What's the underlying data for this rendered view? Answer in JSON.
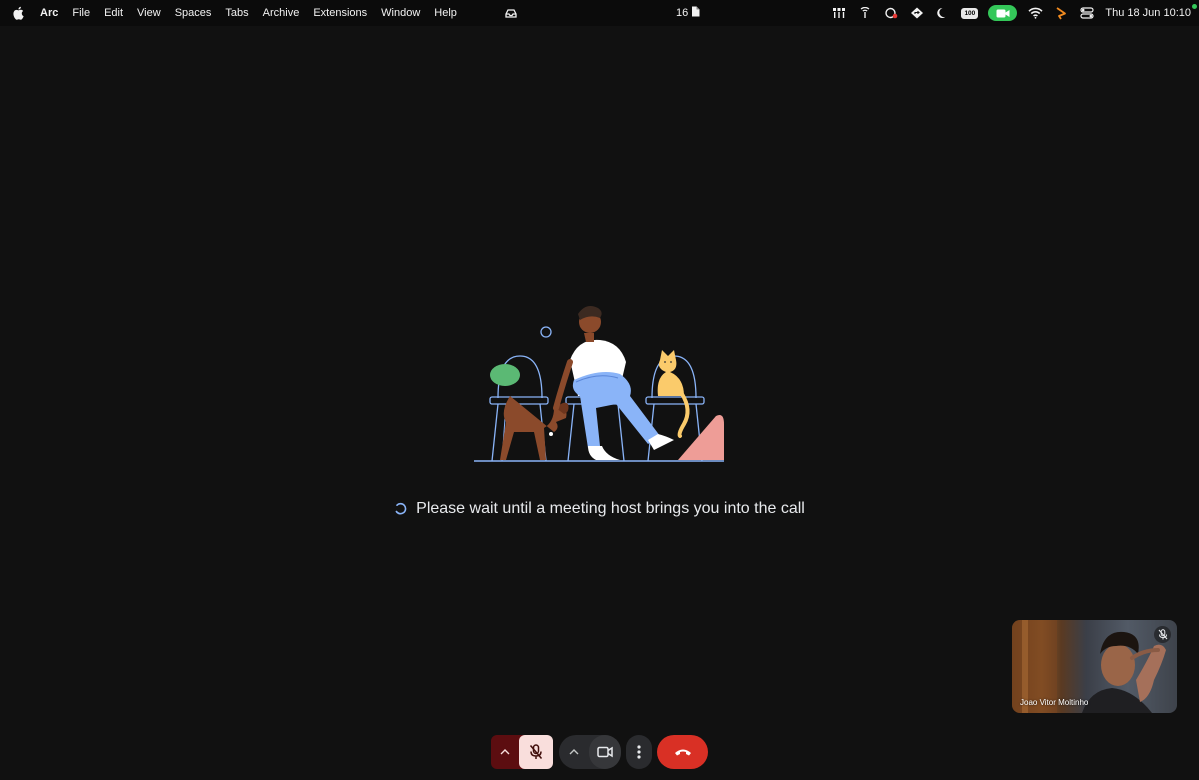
{
  "menubar": {
    "app_name": "Arc",
    "menus": [
      "File",
      "Edit",
      "View",
      "Spaces",
      "Tabs",
      "Archive",
      "Extensions",
      "Window",
      "Help"
    ],
    "center_badge": "16",
    "battery_label": "100",
    "datetime": "Thu 18 Jun  10:10"
  },
  "waiting": {
    "message": "Please wait until a meeting host brings you into the call"
  },
  "self_view": {
    "name": "Joao Vitor Moltinho"
  },
  "colors": {
    "background": "#111111",
    "leave_red": "#d93025",
    "mic_off_bg": "#f9dedc",
    "mic_group_bg": "#5c0d10",
    "facetime_green": "#34c759"
  }
}
